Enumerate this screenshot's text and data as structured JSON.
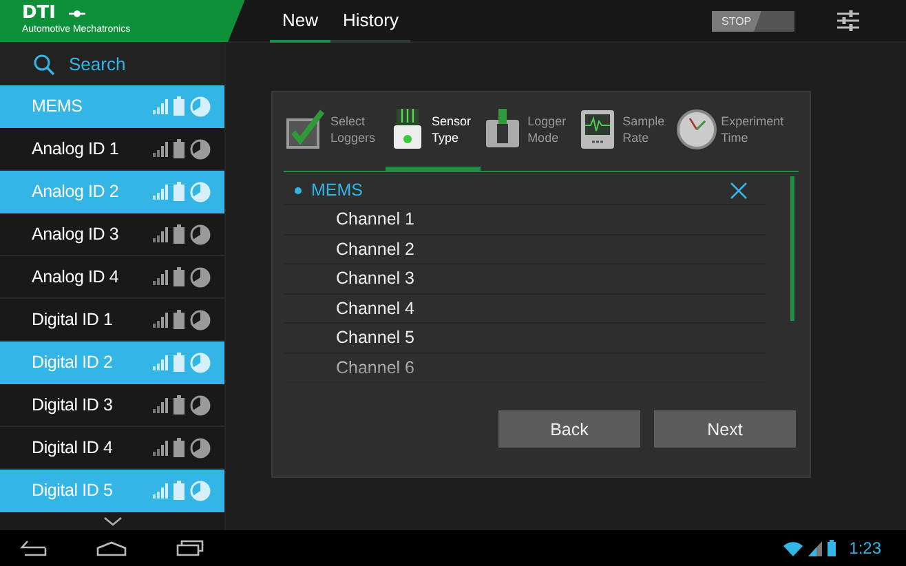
{
  "brand": {
    "name": "DTI",
    "tagline": "Automotive Mechatronics"
  },
  "top_tabs": [
    {
      "label": "New",
      "selected": true
    },
    {
      "label": "History",
      "selected": false
    }
  ],
  "stop_button": {
    "label": "STOP",
    "disabled": true
  },
  "sidebar": {
    "search": "Search",
    "items": [
      {
        "label": "MEMS",
        "selected": true
      },
      {
        "label": "Analog ID 1",
        "selected": false
      },
      {
        "label": "Analog ID 2",
        "selected": true
      },
      {
        "label": "Analog ID 3",
        "selected": false
      },
      {
        "label": "Analog ID 4",
        "selected": false
      },
      {
        "label": "Digital ID 1",
        "selected": false
      },
      {
        "label": "Digital ID 2",
        "selected": true
      },
      {
        "label": "Digital ID 3",
        "selected": false
      },
      {
        "label": "Digital ID 4",
        "selected": false
      },
      {
        "label": "Digital ID 5",
        "selected": true
      }
    ]
  },
  "wizard": {
    "steps": [
      {
        "kind": "check",
        "label": "Select Loggers",
        "selected": false
      },
      {
        "kind": "sensor",
        "label": "Sensor Type",
        "selected": true
      },
      {
        "kind": "switch",
        "label": "Logger Mode",
        "selected": false
      },
      {
        "kind": "monitor",
        "label": "Sample Rate",
        "selected": false
      },
      {
        "kind": "clock",
        "label": "Experiment Time",
        "selected": false
      }
    ],
    "group": "MEMS",
    "channels": [
      "Channel 1",
      "Channel 2",
      "Channel 3",
      "Channel 4",
      "Channel 5",
      "Channel 6"
    ],
    "buttons": [
      "Back",
      "Next"
    ]
  },
  "status_bar": {
    "time": "1:23"
  }
}
